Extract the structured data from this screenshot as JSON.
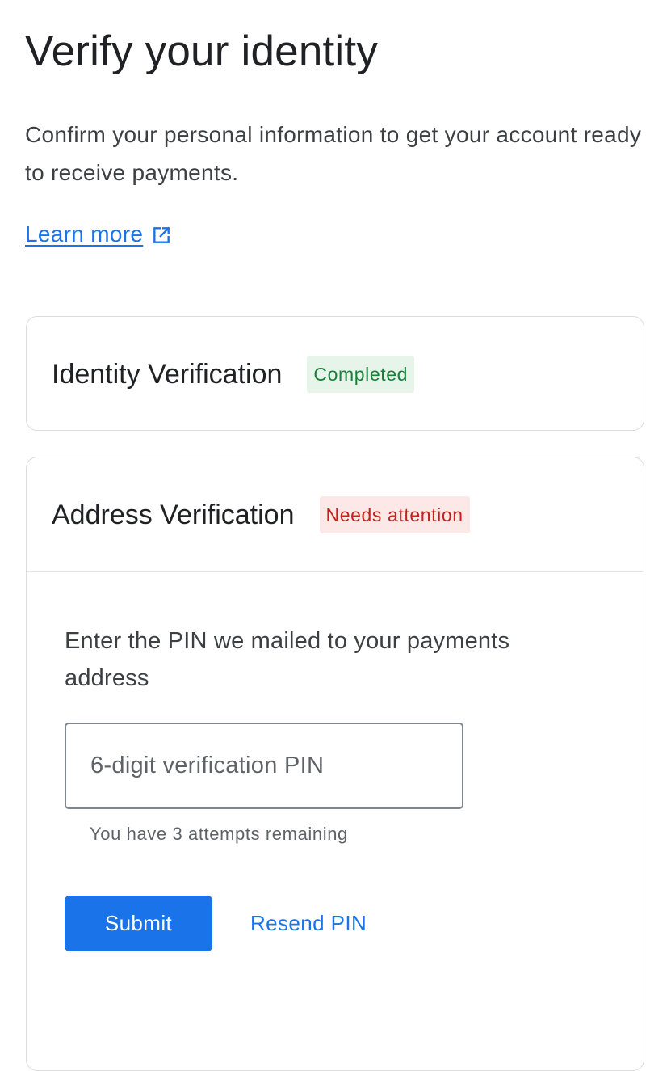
{
  "page": {
    "title": "Verify your identity",
    "subtitle": "Confirm your personal information to get your account ready to receive payments.",
    "learn_more_label": "Learn more",
    "learn_more_icon": "external-link-icon"
  },
  "identity_card": {
    "title": "Identity Verification",
    "status": "Completed"
  },
  "address_card": {
    "title": "Address Verification",
    "status": "Needs attention",
    "prompt": "Enter the PIN we mailed to your payments address",
    "pin_input": {
      "value": "",
      "placeholder": "6-digit verification PIN"
    },
    "attempts_text": "You have 3 attempts remaining",
    "submit_label": "Submit",
    "resend_label": "Resend PIN"
  },
  "colors": {
    "accent": "#1a73e8",
    "success_text": "#188038",
    "success_bg": "#e6f4ea",
    "warning_text": "#c5221f",
    "warning_bg": "#fce8e6",
    "border": "#dadce0"
  }
}
